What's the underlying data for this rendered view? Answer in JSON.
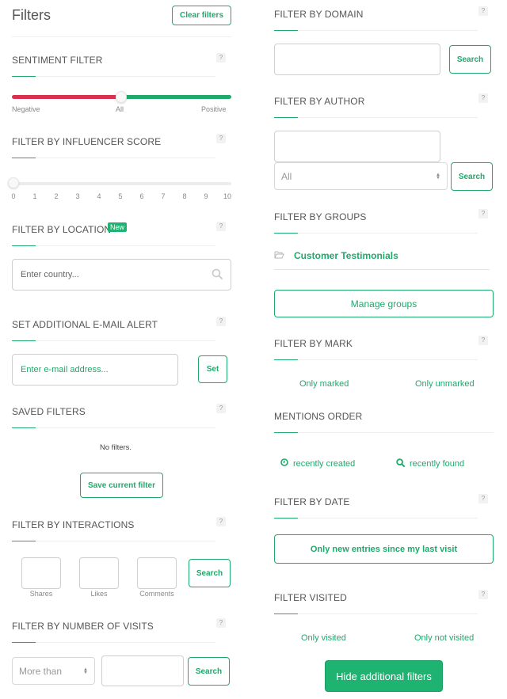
{
  "header": {
    "title": "Filters",
    "clear_filters_label": "Clear filters"
  },
  "help_label": "?",
  "sentiment": {
    "title": "SENTIMENT FILTER",
    "labels": {
      "negative": "Negative",
      "all": "All",
      "positive": "Positive"
    },
    "value": "All",
    "colors": {
      "negative": "#d9304f",
      "positive": "#1fa96b"
    }
  },
  "influencer": {
    "title": "FILTER BY INFLUENCER SCORE",
    "ticks": [
      "0",
      "1",
      "2",
      "3",
      "4",
      "5",
      "6",
      "7",
      "8",
      "9",
      "10"
    ],
    "value": 0,
    "min": 0,
    "max": 10
  },
  "location": {
    "title": "FILTER BY LOCATION",
    "badge": "New",
    "placeholder": "Enter country..."
  },
  "email_alert": {
    "title": "SET ADDITIONAL E-MAIL ALERT",
    "placeholder": "Enter e-mail address...",
    "set_label": "Set"
  },
  "saved_filters": {
    "title": "SAVED FILTERS",
    "empty_text": "No filters.",
    "save_label": "Save current filter"
  },
  "interactions": {
    "title": "FILTER BY INTERACTIONS",
    "fields": [
      {
        "label": "Shares",
        "value": ""
      },
      {
        "label": "Likes",
        "value": ""
      },
      {
        "label": "Comments",
        "value": ""
      }
    ],
    "search_label": "Search"
  },
  "visits": {
    "title": "FILTER BY NUMBER OF VISITS",
    "operator_selected": "More than",
    "value": "",
    "search_label": "Search"
  },
  "domain": {
    "title": "FILTER BY DOMAIN",
    "value": "",
    "search_label": "Search"
  },
  "author": {
    "title": "FILTER BY AUTHOR",
    "value": "",
    "select_selected": "All",
    "search_label": "Search"
  },
  "groups": {
    "title": "FILTER BY GROUPS",
    "items": [
      {
        "label": "Customer Testimonials",
        "icon": "folder-open-icon"
      }
    ],
    "manage_label": "Manage groups"
  },
  "mark": {
    "title": "FILTER BY MARK",
    "options": [
      "Only marked",
      "Only unmarked"
    ]
  },
  "order": {
    "title": "MENTIONS ORDER",
    "options": [
      {
        "label": "recently created",
        "icon": "clock-icon"
      },
      {
        "label": "recently found",
        "icon": "search-icon"
      }
    ]
  },
  "date": {
    "title": "FILTER BY DATE",
    "new_entries_label": "Only new entries since my last visit"
  },
  "visited": {
    "title": "FILTER VISITED",
    "options": [
      "Only visited",
      "Only not visited"
    ]
  },
  "footer": {
    "hide_label": "Hide additional filters"
  },
  "colors": {
    "accent": "#1fa96b",
    "accent_solid": "#1fb371",
    "negative": "#d9304f"
  }
}
